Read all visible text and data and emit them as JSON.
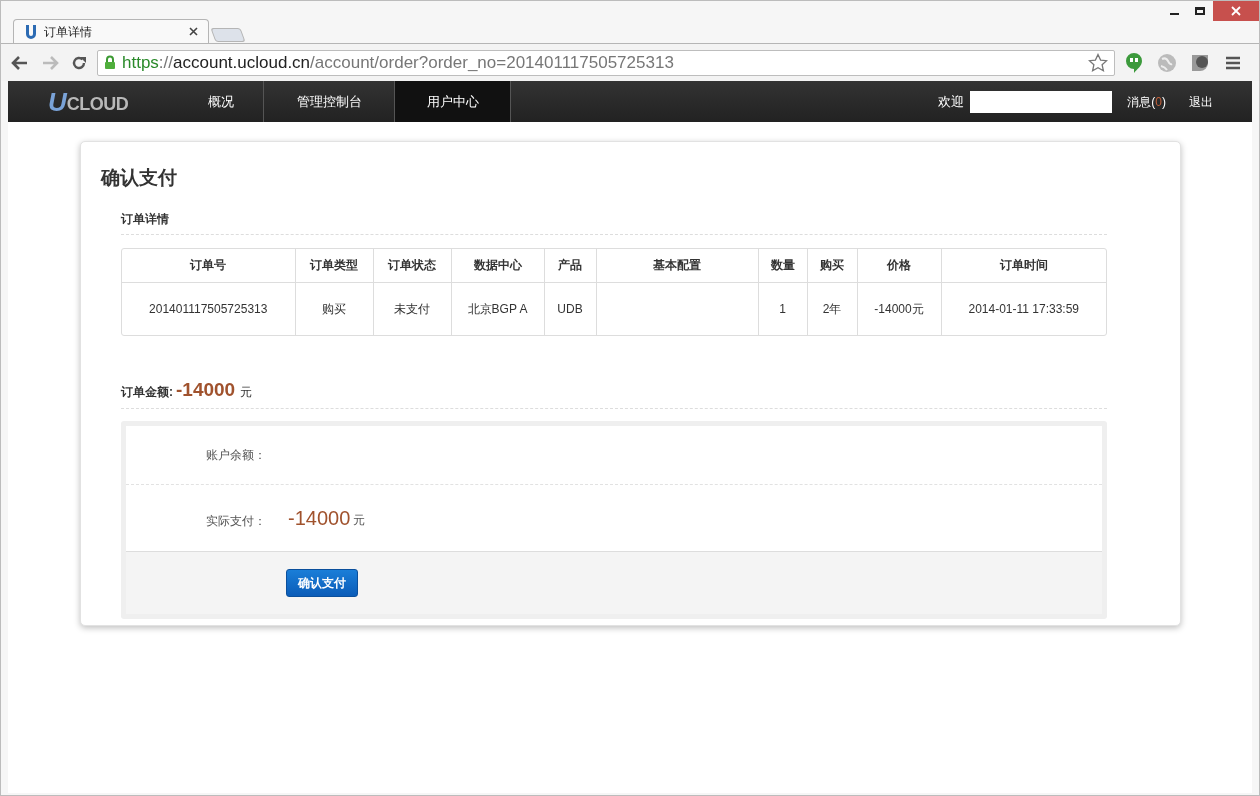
{
  "browser": {
    "tab": {
      "title": "订单详情"
    },
    "url": {
      "scheme": "https",
      "separator": "://",
      "host": "account.ucloud.cn",
      "path": "/account/order?order_no=201401117505725313"
    }
  },
  "navbar": {
    "logo_initial": "U",
    "logo_rest": "CLOUD",
    "items": [
      {
        "label": "概况",
        "selected": false
      },
      {
        "label": "管理控制台",
        "selected": false
      },
      {
        "label": "用户中心",
        "selected": true
      }
    ],
    "welcome": "欢迎",
    "messages": {
      "label": "消息(",
      "count": "0",
      "close": ")"
    },
    "logout": "退出"
  },
  "page": {
    "title": "确认支付",
    "section_title": "订单详情",
    "table": {
      "columns": [
        "订单号",
        "订单类型",
        "订单状态",
        "数据中心",
        "产品",
        "基本配置",
        "数量",
        "购买",
        "价格",
        "订单时间"
      ],
      "rows": [
        [
          "201401117505725313",
          "购买",
          "未支付",
          "北京BGP A",
          "UDB",
          "",
          "1",
          "2年",
          "-14000元",
          "2014-01-11 17:33:59"
        ]
      ]
    },
    "order_amount": {
      "label": "订单金额:",
      "value": "-14000",
      "unit": "元"
    },
    "payment": {
      "balance_label": "账户余额：",
      "actual_label": "实际支付：",
      "actual_value": "-14000",
      "actual_unit": "元",
      "confirm_button": "确认支付"
    }
  }
}
